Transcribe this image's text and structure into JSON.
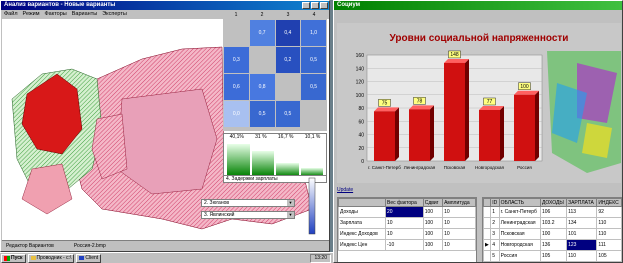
{
  "leftWindow": {
    "title": "Анализ вариантов - Новые варианты",
    "menu": [
      "Файл",
      "Режим",
      "Факторы",
      "Варианты",
      "Эксперты"
    ],
    "matrix": {
      "headers": [
        "1",
        "2",
        "3",
        "4"
      ],
      "rows": [
        [
          "",
          "0,7",
          "0,4",
          "1,0"
        ],
        [
          "0,3",
          "",
          "0,2",
          "0,5"
        ],
        [
          "0,6",
          "0,8",
          "",
          "0,5"
        ],
        [
          "0,0",
          "0,5",
          "0,5",
          ""
        ]
      ]
    },
    "bars": {
      "labels": [
        "40,1%",
        "31 %",
        "16,7 %",
        "10,1 %"
      ],
      "values": [
        40.1,
        31,
        16.7,
        10.1
      ],
      "dropdown": "4. Задержки зарплаты"
    },
    "combos": [
      "2. Зюганов",
      "3. Явлинский"
    ],
    "status": [
      "Редактор Вариантов",
      "Россия-2.bmp"
    ]
  },
  "taskbar": {
    "start": "Пуск",
    "items": [
      "Проводник - c:\\",
      "Client"
    ],
    "clock": "13:20"
  },
  "rightWindow": {
    "title": "Социум",
    "chart_data": {
      "type": "bar",
      "title": "Уровни социальной напряженности",
      "categories": [
        "г. Санкт-Петерб",
        "Ленинградская",
        "Псковская",
        "Новгородская",
        "Россия"
      ],
      "values": [
        75,
        78,
        148,
        77,
        100
      ],
      "ylim": [
        0,
        160
      ],
      "yticks": [
        0,
        20,
        40,
        60,
        80,
        100,
        120,
        140,
        160
      ],
      "colors": [
        "#d01010",
        "#d01010",
        "#d01010",
        "#d01010",
        "#d01010"
      ]
    },
    "updateLink": "Update",
    "factorTable": {
      "headers": [
        "Вес фактора",
        "Сдвиг",
        "Амплитуда"
      ],
      "rows": [
        [
          "Доходы",
          "20",
          "100",
          "10"
        ],
        [
          "Зарплата",
          "10",
          "100",
          "10"
        ],
        [
          "Индекс Доходов",
          "10",
          "100",
          "10"
        ],
        [
          "Индекс Цен",
          "-10",
          "100",
          "10"
        ]
      ]
    },
    "regionTable": {
      "headers": [
        "ID",
        "ОБЛАСТЬ",
        "ДОХОДЫ",
        "ЗАРПЛАТА",
        "ИНДЕКС"
      ],
      "rows": [
        [
          "1",
          "г. Санкт-Петерб",
          "106",
          "113",
          "92"
        ],
        [
          "2",
          "Ленинградская",
          "103.2",
          "134",
          "110"
        ],
        [
          "3",
          "Псковская",
          "100",
          "101",
          "110"
        ],
        [
          "4",
          "Новгородская",
          "136",
          "123",
          "111"
        ],
        [
          "5",
          "Россия",
          "105",
          "110",
          "105"
        ]
      ]
    }
  }
}
